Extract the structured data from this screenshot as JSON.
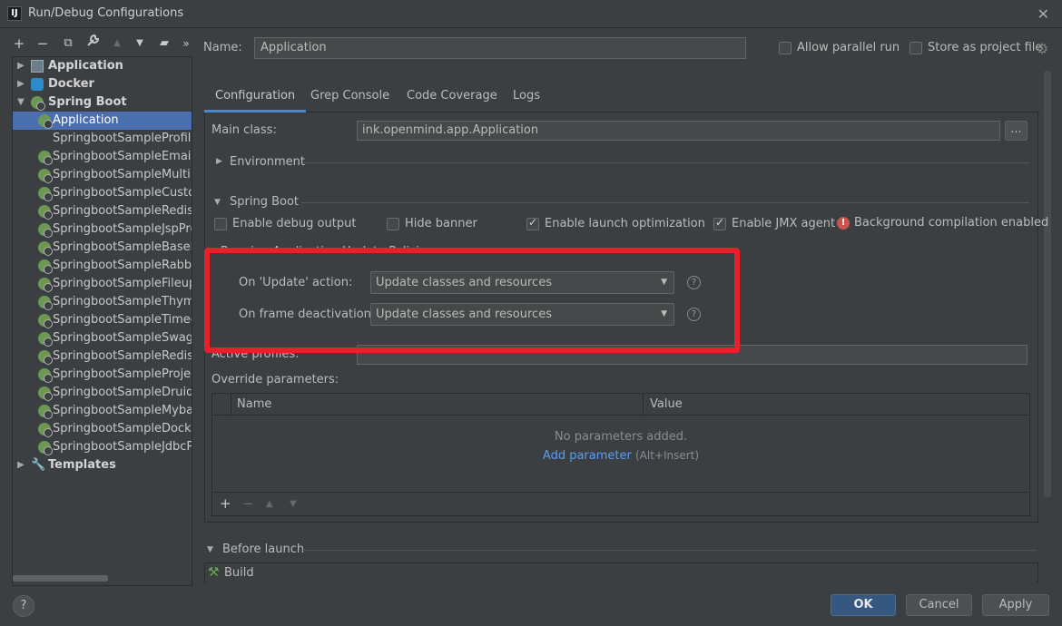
{
  "window": {
    "title": "Run/Debug Configurations",
    "app_icon_text": "IJ"
  },
  "left_toolbar": {
    "buttons": [
      "add-icon",
      "remove-icon",
      "copy-icon",
      "wrench-icon",
      "move-up-icon",
      "move-down-icon",
      "folder-icon",
      "more-icon"
    ],
    "glyphs": {
      "add": "+",
      "remove": "−",
      "copy": "⧉",
      "wrench": "🔧",
      "up": "▲",
      "down": "▼",
      "folder": "▰",
      "more": "»"
    }
  },
  "tree": {
    "groups": [
      {
        "label": "Application"
      },
      {
        "label": "Docker"
      },
      {
        "label": "Spring Boot"
      },
      {
        "label": "Templates"
      }
    ],
    "spring_children": [
      "Application",
      "SpringbootSampleProfileP",
      "SpringbootSampleEmailPr",
      "SpringbootSampleMultiDa",
      "SpringbootSampleCustom",
      "SpringbootSampleRedisPr",
      "SpringbootSampleJspProje",
      "SpringbootSampleBaselea",
      "SpringbootSampleRabbitn",
      "SpringbootSampleFileuplo",
      "SpringbootSampleThymele",
      "SpringbootSampleTimedta",
      "SpringbootSampleSwagge",
      "SpringbootSampleRedisLe",
      "SpringbootSampleProjectA",
      "SpringbootSampleDruidPr",
      "SpringbootSampleMybatis",
      "SpringbootSampleDockerl",
      "SpringbootSampleJdbcPro"
    ]
  },
  "header": {
    "name_label": "Name:",
    "name_value": "Application",
    "allow_parallel_label": "Allow parallel run",
    "store_as_project_label": "Store as project file"
  },
  "tabs": [
    "Configuration",
    "Grep Console",
    "Code Coverage",
    "Logs"
  ],
  "config": {
    "main_class_label": "Main class:",
    "main_class_value": "ink.openmind.app.Application",
    "browse_label": "...",
    "environment_label": "Environment",
    "spring_boot_label": "Spring Boot",
    "enable_debug_label": "Enable debug output",
    "hide_banner_label": "Hide banner",
    "enable_launch_opt_label": "Enable launch optimization",
    "enable_jmx_label": "Enable JMX agent",
    "bg_compilation_label": "Background compilation enabled",
    "running_policies_label": "Running Application Update Policies",
    "on_update_label": "On 'Update' action:",
    "on_update_value": "Update classes and resources",
    "on_frame_label": "On frame deactivation:",
    "on_frame_value": "Update classes and resources",
    "help_glyph": "?",
    "active_profiles_label": "Active profiles:",
    "override_params_label": "Override parameters:"
  },
  "params_table": {
    "columns": [
      "Name",
      "Value"
    ],
    "empty_text": "No parameters added.",
    "add_link": "Add parameter",
    "add_hint": "(Alt+Insert)"
  },
  "before_launch": {
    "label": "Before launch",
    "items": [
      "Build"
    ]
  },
  "footer": {
    "help": "?",
    "ok": "OK",
    "cancel": "Cancel",
    "apply": "Apply"
  },
  "colors": {
    "accent": "#4b6eaf",
    "highlight_box": "#e8202a",
    "link": "#589df6",
    "error": "#c75450",
    "ok_button": "#365880"
  }
}
